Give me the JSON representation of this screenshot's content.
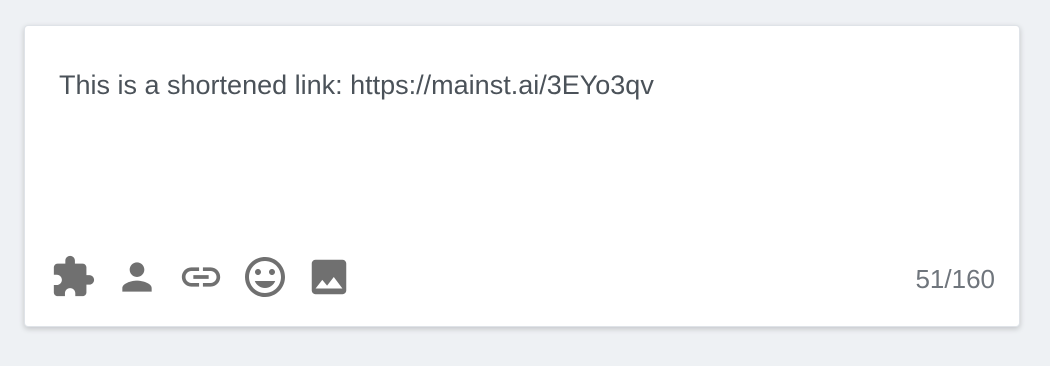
{
  "composer": {
    "text": "This is a shortened link: https://mainst.ai/3EYo3qv",
    "char_count": "51/160"
  },
  "toolbar": {
    "icons": [
      "puzzle-icon",
      "person-icon",
      "link-icon",
      "emoji-icon",
      "image-icon"
    ]
  },
  "colors": {
    "background": "#eef1f4",
    "card": "#ffffff",
    "text": "#4b5259",
    "icon": "#707070",
    "counter": "#6f757c"
  }
}
